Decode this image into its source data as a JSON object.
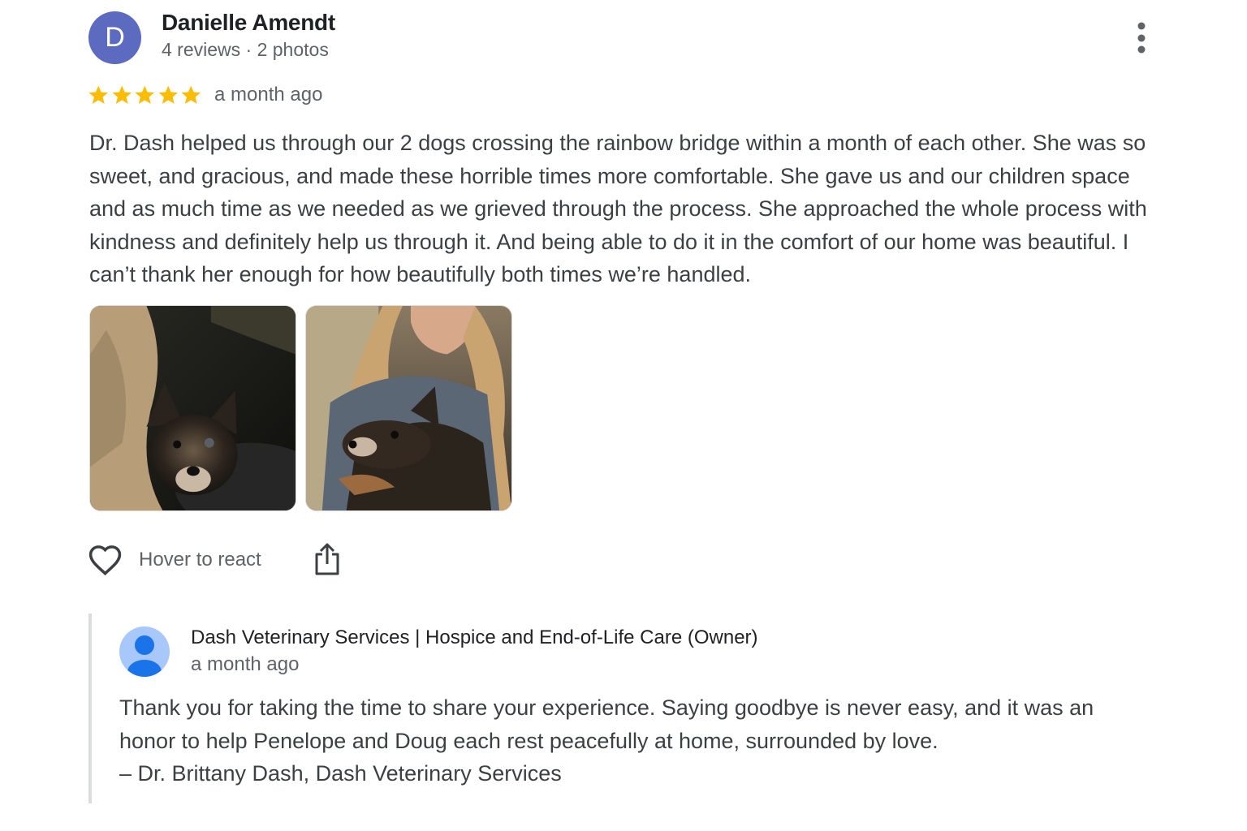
{
  "review": {
    "avatar_letter": "D",
    "avatar_color": "#5c6bc0",
    "reviewer_name": "Danielle Amendt",
    "reviewer_meta": "4 reviews · 2 photos",
    "rating": 5,
    "rating_max": 5,
    "star_color": "#fbbc04",
    "time": "a month ago",
    "text": "Dr. Dash helped us through our 2 dogs crossing the rainbow bridge within a month of each other. She was so sweet, and gracious, and made these horrible times more comfortable. She gave us and our children space and as much time as we needed as we grieved through the process. She approached the whole process with kindness and definitely help us through it. And being able to do it in the comfort of our home was beautiful. I can’t thank her enough for how beautifully both times we’re handled.",
    "photos": [
      {
        "icon": "dog-photo-thumbnail"
      },
      {
        "icon": "dog-photo-thumbnail"
      }
    ],
    "react_label": "Hover to react",
    "react_icon": "heart-outline-icon",
    "share_icon": "share-icon",
    "more_icon": "more-vertical-icon"
  },
  "owner_response": {
    "avatar_icon": "person-avatar-icon",
    "avatar_color": "#4285f4",
    "name": "Dash Veterinary Services | Hospice and End-of-Life Care (Owner)",
    "time": "a month ago",
    "reply_lines": [
      "Thank you for taking the time to share your experience. Saying goodbye is never easy, and it was an",
      "honor to help Penelope and Doug each rest peacefully at home, surrounded by love.",
      "– Dr. Brittany Dash, Dash Veterinary Services"
    ]
  }
}
